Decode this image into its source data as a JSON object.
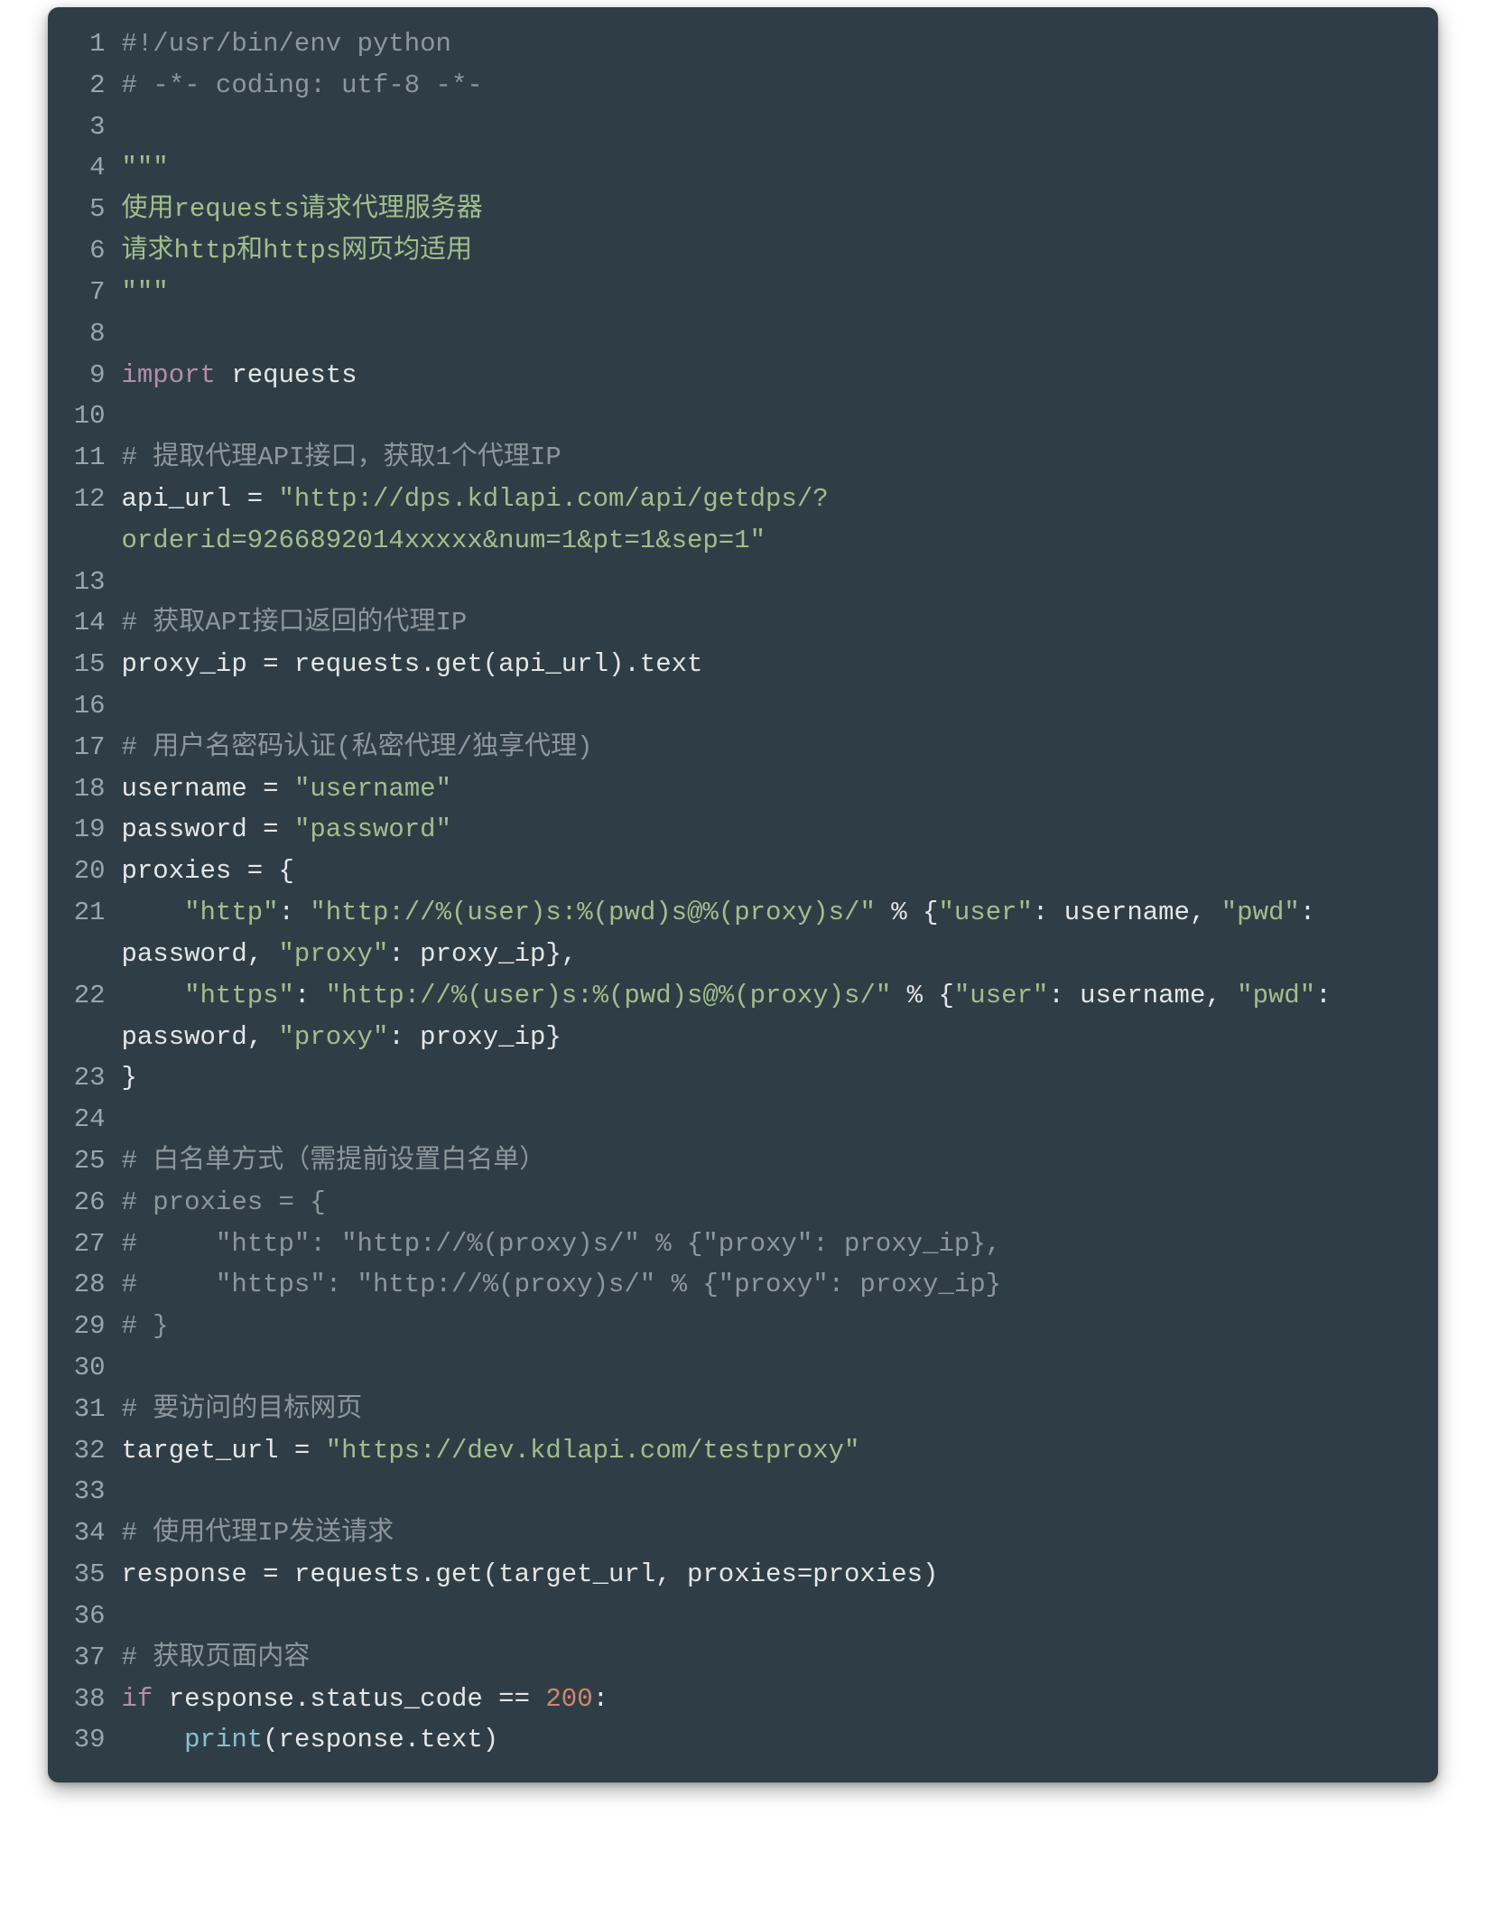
{
  "code": {
    "lines": [
      {
        "n": "1",
        "tokens": [
          {
            "cls": "tok-comment",
            "t": "#!/usr/bin/env python"
          }
        ]
      },
      {
        "n": "2",
        "tokens": [
          {
            "cls": "tok-comment",
            "t": "# -*- coding: utf-8 -*-"
          }
        ]
      },
      {
        "n": "3",
        "tokens": [
          {
            "cls": "tok-default",
            "t": ""
          }
        ]
      },
      {
        "n": "4",
        "tokens": [
          {
            "cls": "tok-string",
            "t": "\"\"\""
          }
        ]
      },
      {
        "n": "5",
        "tokens": [
          {
            "cls": "tok-string",
            "t": "使用requests请求代理服务器"
          }
        ]
      },
      {
        "n": "6",
        "tokens": [
          {
            "cls": "tok-string",
            "t": "请求http和https网页均适用"
          }
        ]
      },
      {
        "n": "7",
        "tokens": [
          {
            "cls": "tok-string",
            "t": "\"\"\""
          }
        ]
      },
      {
        "n": "8",
        "tokens": [
          {
            "cls": "tok-default",
            "t": ""
          }
        ]
      },
      {
        "n": "9",
        "tokens": [
          {
            "cls": "tok-keyword",
            "t": "import"
          },
          {
            "cls": "tok-default",
            "t": " requests"
          }
        ]
      },
      {
        "n": "10",
        "tokens": [
          {
            "cls": "tok-default",
            "t": ""
          }
        ]
      },
      {
        "n": "11",
        "tokens": [
          {
            "cls": "tok-comment",
            "t": "# 提取代理API接口，获取1个代理IP"
          }
        ]
      },
      {
        "n": "12",
        "tokens": [
          {
            "cls": "tok-default",
            "t": "api_url = "
          },
          {
            "cls": "tok-string",
            "t": "\"http://dps.kdlapi.com/api/getdps/?orderid=9266892014xxxxx&num=1&pt=1&sep=1\""
          }
        ]
      },
      {
        "n": "13",
        "tokens": [
          {
            "cls": "tok-default",
            "t": ""
          }
        ]
      },
      {
        "n": "14",
        "tokens": [
          {
            "cls": "tok-comment",
            "t": "# 获取API接口返回的代理IP"
          }
        ]
      },
      {
        "n": "15",
        "tokens": [
          {
            "cls": "tok-default",
            "t": "proxy_ip = requests.get(api_url).text"
          }
        ]
      },
      {
        "n": "16",
        "tokens": [
          {
            "cls": "tok-default",
            "t": ""
          }
        ]
      },
      {
        "n": "17",
        "tokens": [
          {
            "cls": "tok-comment",
            "t": "# 用户名密码认证(私密代理/独享代理)"
          }
        ]
      },
      {
        "n": "18",
        "tokens": [
          {
            "cls": "tok-default",
            "t": "username = "
          },
          {
            "cls": "tok-string",
            "t": "\"username\""
          }
        ]
      },
      {
        "n": "19",
        "tokens": [
          {
            "cls": "tok-default",
            "t": "password = "
          },
          {
            "cls": "tok-string",
            "t": "\"password\""
          }
        ]
      },
      {
        "n": "20",
        "tokens": [
          {
            "cls": "tok-default",
            "t": "proxies = {"
          }
        ]
      },
      {
        "n": "21",
        "tokens": [
          {
            "cls": "tok-default",
            "t": "    "
          },
          {
            "cls": "tok-string",
            "t": "\"http\""
          },
          {
            "cls": "tok-default",
            "t": ": "
          },
          {
            "cls": "tok-string",
            "t": "\"http://%(user)s:%(pwd)s@%(proxy)s/\""
          },
          {
            "cls": "tok-default",
            "t": " % {"
          },
          {
            "cls": "tok-string",
            "t": "\"user\""
          },
          {
            "cls": "tok-default",
            "t": ": username, "
          },
          {
            "cls": "tok-string",
            "t": "\"pwd\""
          },
          {
            "cls": "tok-default",
            "t": ": password, "
          },
          {
            "cls": "tok-string",
            "t": "\"proxy\""
          },
          {
            "cls": "tok-default",
            "t": ": proxy_ip},"
          }
        ]
      },
      {
        "n": "22",
        "tokens": [
          {
            "cls": "tok-default",
            "t": "    "
          },
          {
            "cls": "tok-string",
            "t": "\"https\""
          },
          {
            "cls": "tok-default",
            "t": ": "
          },
          {
            "cls": "tok-string",
            "t": "\"http://%(user)s:%(pwd)s@%(proxy)s/\""
          },
          {
            "cls": "tok-default",
            "t": " % {"
          },
          {
            "cls": "tok-string",
            "t": "\"user\""
          },
          {
            "cls": "tok-default",
            "t": ": username, "
          },
          {
            "cls": "tok-string",
            "t": "\"pwd\""
          },
          {
            "cls": "tok-default",
            "t": ": password, "
          },
          {
            "cls": "tok-string",
            "t": "\"proxy\""
          },
          {
            "cls": "tok-default",
            "t": ": proxy_ip}"
          }
        ]
      },
      {
        "n": "23",
        "tokens": [
          {
            "cls": "tok-default",
            "t": "}"
          }
        ]
      },
      {
        "n": "24",
        "tokens": [
          {
            "cls": "tok-default",
            "t": ""
          }
        ]
      },
      {
        "n": "25",
        "tokens": [
          {
            "cls": "tok-comment",
            "t": "# 白名单方式（需提前设置白名单）"
          }
        ]
      },
      {
        "n": "26",
        "tokens": [
          {
            "cls": "tok-comment",
            "t": "# proxies = {"
          }
        ]
      },
      {
        "n": "27",
        "tokens": [
          {
            "cls": "tok-comment",
            "t": "#     \"http\": \"http://%(proxy)s/\" % {\"proxy\": proxy_ip},"
          }
        ]
      },
      {
        "n": "28",
        "tokens": [
          {
            "cls": "tok-comment",
            "t": "#     \"https\": \"http://%(proxy)s/\" % {\"proxy\": proxy_ip}"
          }
        ]
      },
      {
        "n": "29",
        "tokens": [
          {
            "cls": "tok-comment",
            "t": "# }"
          }
        ]
      },
      {
        "n": "30",
        "tokens": [
          {
            "cls": "tok-default",
            "t": ""
          }
        ]
      },
      {
        "n": "31",
        "tokens": [
          {
            "cls": "tok-comment",
            "t": "# 要访问的目标网页"
          }
        ]
      },
      {
        "n": "32",
        "tokens": [
          {
            "cls": "tok-default",
            "t": "target_url = "
          },
          {
            "cls": "tok-string",
            "t": "\"https://dev.kdlapi.com/testproxy\""
          }
        ]
      },
      {
        "n": "33",
        "tokens": [
          {
            "cls": "tok-default",
            "t": ""
          }
        ]
      },
      {
        "n": "34",
        "tokens": [
          {
            "cls": "tok-comment",
            "t": "# 使用代理IP发送请求"
          }
        ]
      },
      {
        "n": "35",
        "tokens": [
          {
            "cls": "tok-default",
            "t": "response = requests.get(target_url, proxies=proxies)"
          }
        ]
      },
      {
        "n": "36",
        "tokens": [
          {
            "cls": "tok-default",
            "t": ""
          }
        ]
      },
      {
        "n": "37",
        "tokens": [
          {
            "cls": "tok-comment",
            "t": "# 获取页面内容"
          }
        ]
      },
      {
        "n": "38",
        "tokens": [
          {
            "cls": "tok-keyword",
            "t": "if"
          },
          {
            "cls": "tok-default",
            "t": " response.status_code == "
          },
          {
            "cls": "tok-number",
            "t": "200"
          },
          {
            "cls": "tok-default",
            "t": ":"
          }
        ]
      },
      {
        "n": "39",
        "tokens": [
          {
            "cls": "tok-default",
            "t": "    "
          },
          {
            "cls": "tok-builtin",
            "t": "print"
          },
          {
            "cls": "tok-default",
            "t": "(response.text)"
          }
        ]
      }
    ]
  }
}
